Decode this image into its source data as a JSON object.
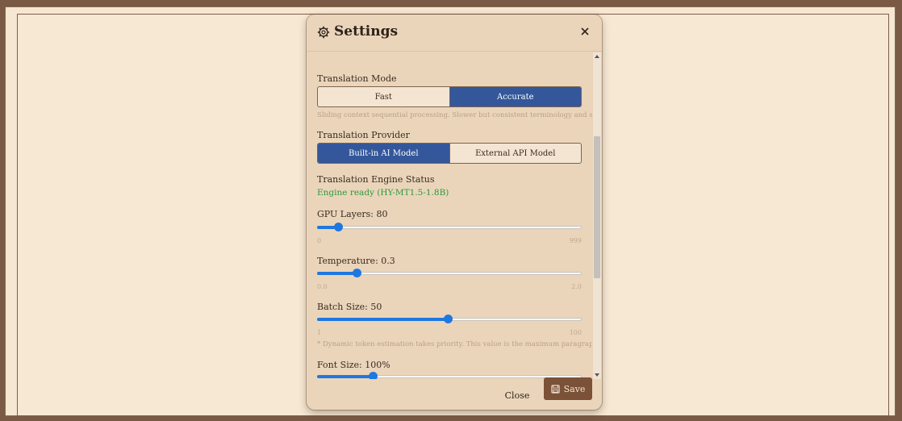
{
  "dialog": {
    "title": "Settings",
    "title_icon": "gear-icon",
    "close_icon": "close-icon"
  },
  "translation_mode": {
    "label": "Translation Mode",
    "options": [
      "Fast",
      "Accurate"
    ],
    "selected": "Accurate",
    "hint": "Sliding context sequential processing. Slower but consistent terminology and style."
  },
  "translation_provider": {
    "label": "Translation Provider",
    "options": [
      "Built-in AI Model",
      "External API Model"
    ],
    "selected": "Built-in AI Model"
  },
  "engine_status": {
    "label": "Translation Engine Status",
    "value": "Engine ready (HY-MT1.5-1.8B)"
  },
  "gpu_layers": {
    "label": "GPU Layers: 80",
    "value": 80,
    "min_label": "0",
    "max_label": "999",
    "min": 0,
    "max": 999
  },
  "temperature": {
    "label": "Temperature: 0.3",
    "value": 0.3,
    "min_label": "0.0",
    "max_label": "2.0",
    "min": 0,
    "max": 2
  },
  "batch_size": {
    "label": "Batch Size: 50",
    "value": 50,
    "min_label": "1",
    "max_label": "100",
    "min": 1,
    "max": 100,
    "hint": "* Dynamic token estimation takes priority. This value is the maximum paragraph cap."
  },
  "font_size": {
    "label": "Font Size: 100%",
    "value_fraction": 0.21
  },
  "footer": {
    "close_label": "Close",
    "save_label": "Save",
    "save_icon": "save-icon"
  },
  "colors": {
    "accent": "#33579a",
    "slider": "#1f78e0",
    "save_button": "#7b5138",
    "status_ok": "#2a9a3a"
  }
}
